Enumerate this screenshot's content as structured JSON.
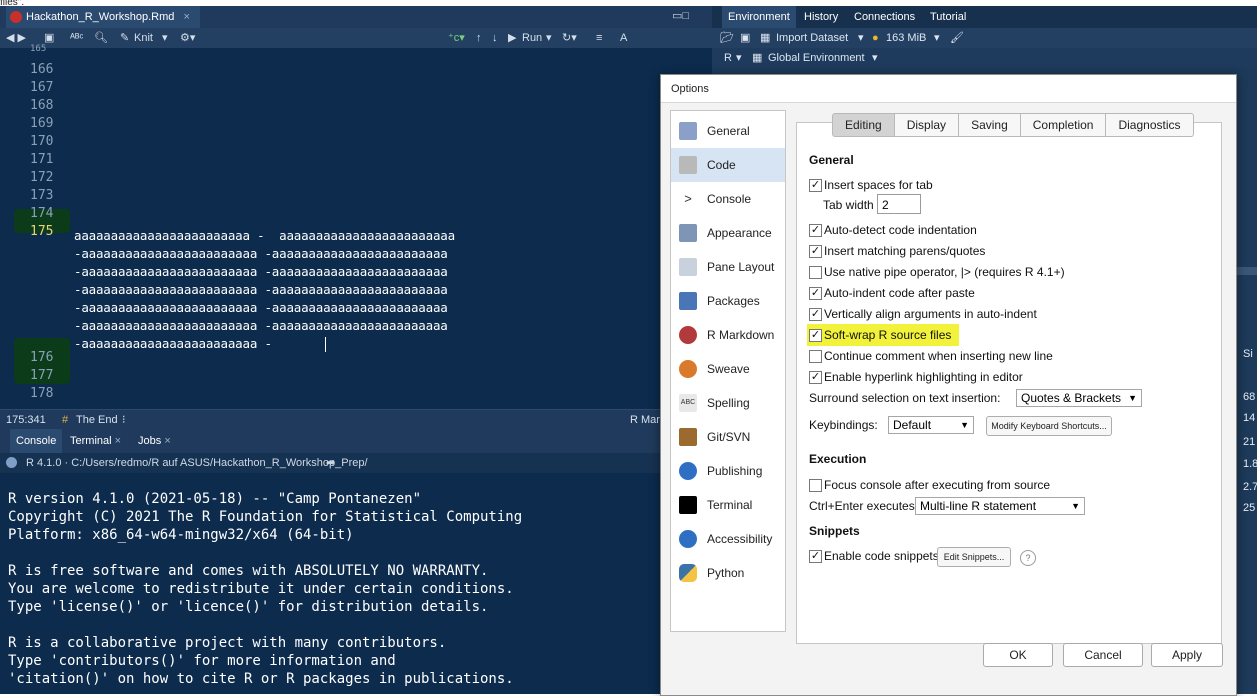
{
  "top_text": "files\".",
  "editor": {
    "file_tab": "Hackathon_R_Workshop.Rmd",
    "toolbar": {
      "knit": "Knit",
      "run": "Run"
    },
    "lines": [
      {
        "num": "165",
        "text": ""
      },
      {
        "num": "166",
        "text": ""
      },
      {
        "num": "167",
        "text": ""
      },
      {
        "num": "168",
        "text": ""
      },
      {
        "num": "169",
        "text": ""
      },
      {
        "num": "170",
        "text": ""
      },
      {
        "num": "171",
        "text": ""
      },
      {
        "num": "172",
        "text": ""
      },
      {
        "num": "173",
        "text": ""
      },
      {
        "num": "174",
        "text": ""
      },
      {
        "num": "175",
        "text": ""
      }
    ],
    "code_wrap": [
      "aaaaaaaaaaaaaaaaaaaaaaaa -  aaaaaaaaaaaaaaaaaaaaaaaa",
      "-aaaaaaaaaaaaaaaaaaaaaaaa -aaaaaaaaaaaaaaaaaaaaaaaa",
      "-aaaaaaaaaaaaaaaaaaaaaaaa -aaaaaaaaaaaaaaaaaaaaaaaa",
      "-aaaaaaaaaaaaaaaaaaaaaaaa -aaaaaaaaaaaaaaaaaaaaaaaa",
      "-aaaaaaaaaaaaaaaaaaaaaaaa -aaaaaaaaaaaaaaaaaaaaaaaa",
      "-aaaaaaaaaaaaaaaaaaaaaaaa -aaaaaaaaaaaaaaaaaaaaaaaa",
      "-aaaaaaaaaaaaaaaaaaaaaaaa -"
    ],
    "after_lines": [
      "176",
      "177",
      "178"
    ],
    "status": {
      "position": "175:341",
      "section": "The End",
      "mode": "R Mar"
    }
  },
  "console": {
    "tabs": [
      "Console",
      "Terminal",
      "Jobs"
    ],
    "path": "R 4.1.0 · C:/Users/redmo/R auf ASUS/Hackathon_R_Workshop_Prep/",
    "lines": [
      "",
      "R version 4.1.0 (2021-05-18) -- \"Camp Pontanezen\"",
      "Copyright (C) 2021 The R Foundation for Statistical Computing",
      "Platform: x86_64-w64-mingw32/x64 (64-bit)",
      "",
      "R is free software and comes with ABSOLUTELY NO WARRANTY.",
      "You are welcome to redistribute it under certain conditions.",
      "Type 'license()' or 'licence()' for distribution details.",
      "",
      "R is a collaborative project with many contributors.",
      "Type 'contributors()' for more information and",
      "'citation()' on how to cite R or R packages in publications."
    ]
  },
  "env": {
    "tabs": [
      "Environment",
      "History",
      "Connections",
      "Tutorial"
    ],
    "import": "Import Dataset",
    "memory": "163 MiB",
    "scope_r": "R",
    "scope": "Global Environment",
    "side_values": [
      "Si",
      "68",
      "14",
      "21",
      "1.8",
      "2.7",
      "25"
    ]
  },
  "dialog": {
    "title": "Options",
    "nav": [
      {
        "label": "General",
        "icon": "r-logo-icon",
        "color": "#8aa0c8"
      },
      {
        "label": "Code",
        "icon": "code-page-icon",
        "color": "#b9b9b9"
      },
      {
        "label": "Console",
        "icon": "console-prompt-icon",
        "color": "#ffffff"
      },
      {
        "label": "Appearance",
        "icon": "paint-bucket-icon",
        "color": "#7e95b5"
      },
      {
        "label": "Pane Layout",
        "icon": "pane-layout-icon",
        "color": "#c8d1dc"
      },
      {
        "label": "Packages",
        "icon": "packages-icon",
        "color": "#4a76b8"
      },
      {
        "label": "R Markdown",
        "icon": "rmd-icon",
        "color": "#b33a3a"
      },
      {
        "label": "Sweave",
        "icon": "sweave-icon",
        "color": "#d9792b"
      },
      {
        "label": "Spelling",
        "icon": "spelling-icon",
        "color": "#e8e8e8"
      },
      {
        "label": "Git/SVN",
        "icon": "git-box-icon",
        "color": "#9c6a2f"
      },
      {
        "label": "Publishing",
        "icon": "publishing-icon",
        "color": "#2e6fc4"
      },
      {
        "label": "Terminal",
        "icon": "terminal-icon",
        "color": "#000000"
      },
      {
        "label": "Accessibility",
        "icon": "accessibility-icon",
        "color": "#2e6fc4"
      },
      {
        "label": "Python",
        "icon": "python-icon",
        "color": "#3b73a8"
      }
    ],
    "tabs": [
      "Editing",
      "Display",
      "Saving",
      "Completion",
      "Diagnostics"
    ],
    "general": "General",
    "options": [
      {
        "label": "Insert spaces for tab",
        "checked": true
      },
      {
        "label": "Auto-detect code indentation",
        "checked": true
      },
      {
        "label": "Insert matching parens/quotes",
        "checked": true
      },
      {
        "label": "Use native pipe operator, |> (requires R 4.1+)",
        "checked": false
      },
      {
        "label": "Auto-indent code after paste",
        "checked": true
      },
      {
        "label": "Vertically align arguments in auto-indent",
        "checked": true
      },
      {
        "label": "Soft-wrap R source files",
        "checked": true
      },
      {
        "label": "Continue comment when inserting new line",
        "checked": false
      },
      {
        "label": "Enable hyperlink highlighting in editor",
        "checked": true
      }
    ],
    "tab_width_label": "Tab width",
    "tab_width": "2",
    "surround_label": "Surround selection on text insertion:",
    "surround_value": "Quotes & Brackets",
    "keybindings_label": "Keybindings:",
    "keybindings_value": "Default",
    "modify_shortcuts": "Modify Keyboard Shortcuts...",
    "execution": "Execution",
    "focus_console": "Focus console after executing from source",
    "ctrl_enter_label": "Ctrl+Enter executes:",
    "ctrl_enter_value": "Multi-line R statement",
    "snippets": "Snippets",
    "enable_snippets": "Enable code snippets",
    "edit_snippets": "Edit Snippets...",
    "help": "?",
    "ok": "OK",
    "cancel": "Cancel",
    "apply": "Apply",
    "highlight_color": "#f2f23a"
  }
}
